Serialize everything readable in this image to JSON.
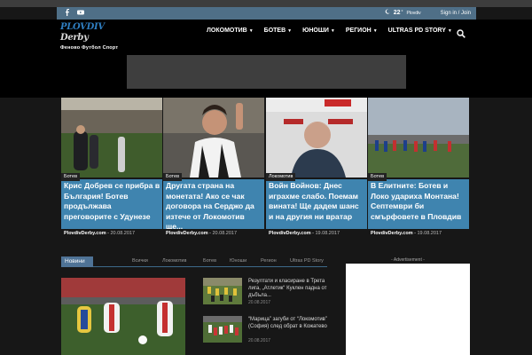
{
  "topbar": {
    "social": [
      "facebook-icon",
      "youtube-icon"
    ],
    "weather_temp": "22",
    "weather_unit": "°",
    "weather_city": "Plovdiv",
    "sign_in": "Sign in / Join"
  },
  "logo": {
    "brand": "PLOVDIV",
    "brand2": "Derby",
    "tagline": "Феново Футбол Спорт"
  },
  "nav": {
    "items": [
      {
        "label": "ЛОКОМОТИВ"
      },
      {
        "label": "БОТЕВ"
      },
      {
        "label": "ЮНОШИ"
      },
      {
        "label": "РЕГИОН"
      },
      {
        "label": "ULTRAS PD STORY"
      }
    ]
  },
  "tiles": [
    {
      "category": "Ботев",
      "title": "Крис Добрев се прибра в България! Ботев продължава преговорите с Удунезе",
      "source": "PlovdivDerby.com",
      "date": "20.08.2017"
    },
    {
      "category": "Ботев",
      "title": "Другата страна на монетата! Ако се чак договора на Серджо да изтече от Локомотив ще...",
      "source": "PlovdivDerby.com",
      "date": "20.08.2017"
    },
    {
      "category": "Локомотив",
      "title": "Войн Войнов: Днес играхме слабо. Поемам вината! Ще дадем шанс и на другия ни вратар",
      "source": "PlovdivDerby.com",
      "date": "19.08.2017"
    },
    {
      "category": "Ботев",
      "title": "В Елитните: Ботев и Локо удариха Монтана! Септември би смърфовете в Пловдив",
      "source": "PlovdivDerby.com",
      "date": "19.08.2017"
    }
  ],
  "news_block": {
    "active_tab": "Новини",
    "tabs": [
      "Всички",
      "Локомотив",
      "Ботев",
      "Юноши",
      "Регион",
      "Ultras PD Story"
    ],
    "items": [
      {
        "title": "Резултати и класиране в Трета лига, „Атлетик“ Куклен падна от дъбъла...",
        "date": "20.08.2017"
      },
      {
        "title": "“Марица” загуби от “Локомотив” (София) след обрат в Кожатево",
        "date": "20.08.2017"
      }
    ]
  },
  "sidebar": {
    "ad_label": "- Advertisement -"
  },
  "colors": {
    "topbar": "#4f6f87",
    "accent": "#4f7396",
    "caption_overlay": "#4696c8"
  }
}
